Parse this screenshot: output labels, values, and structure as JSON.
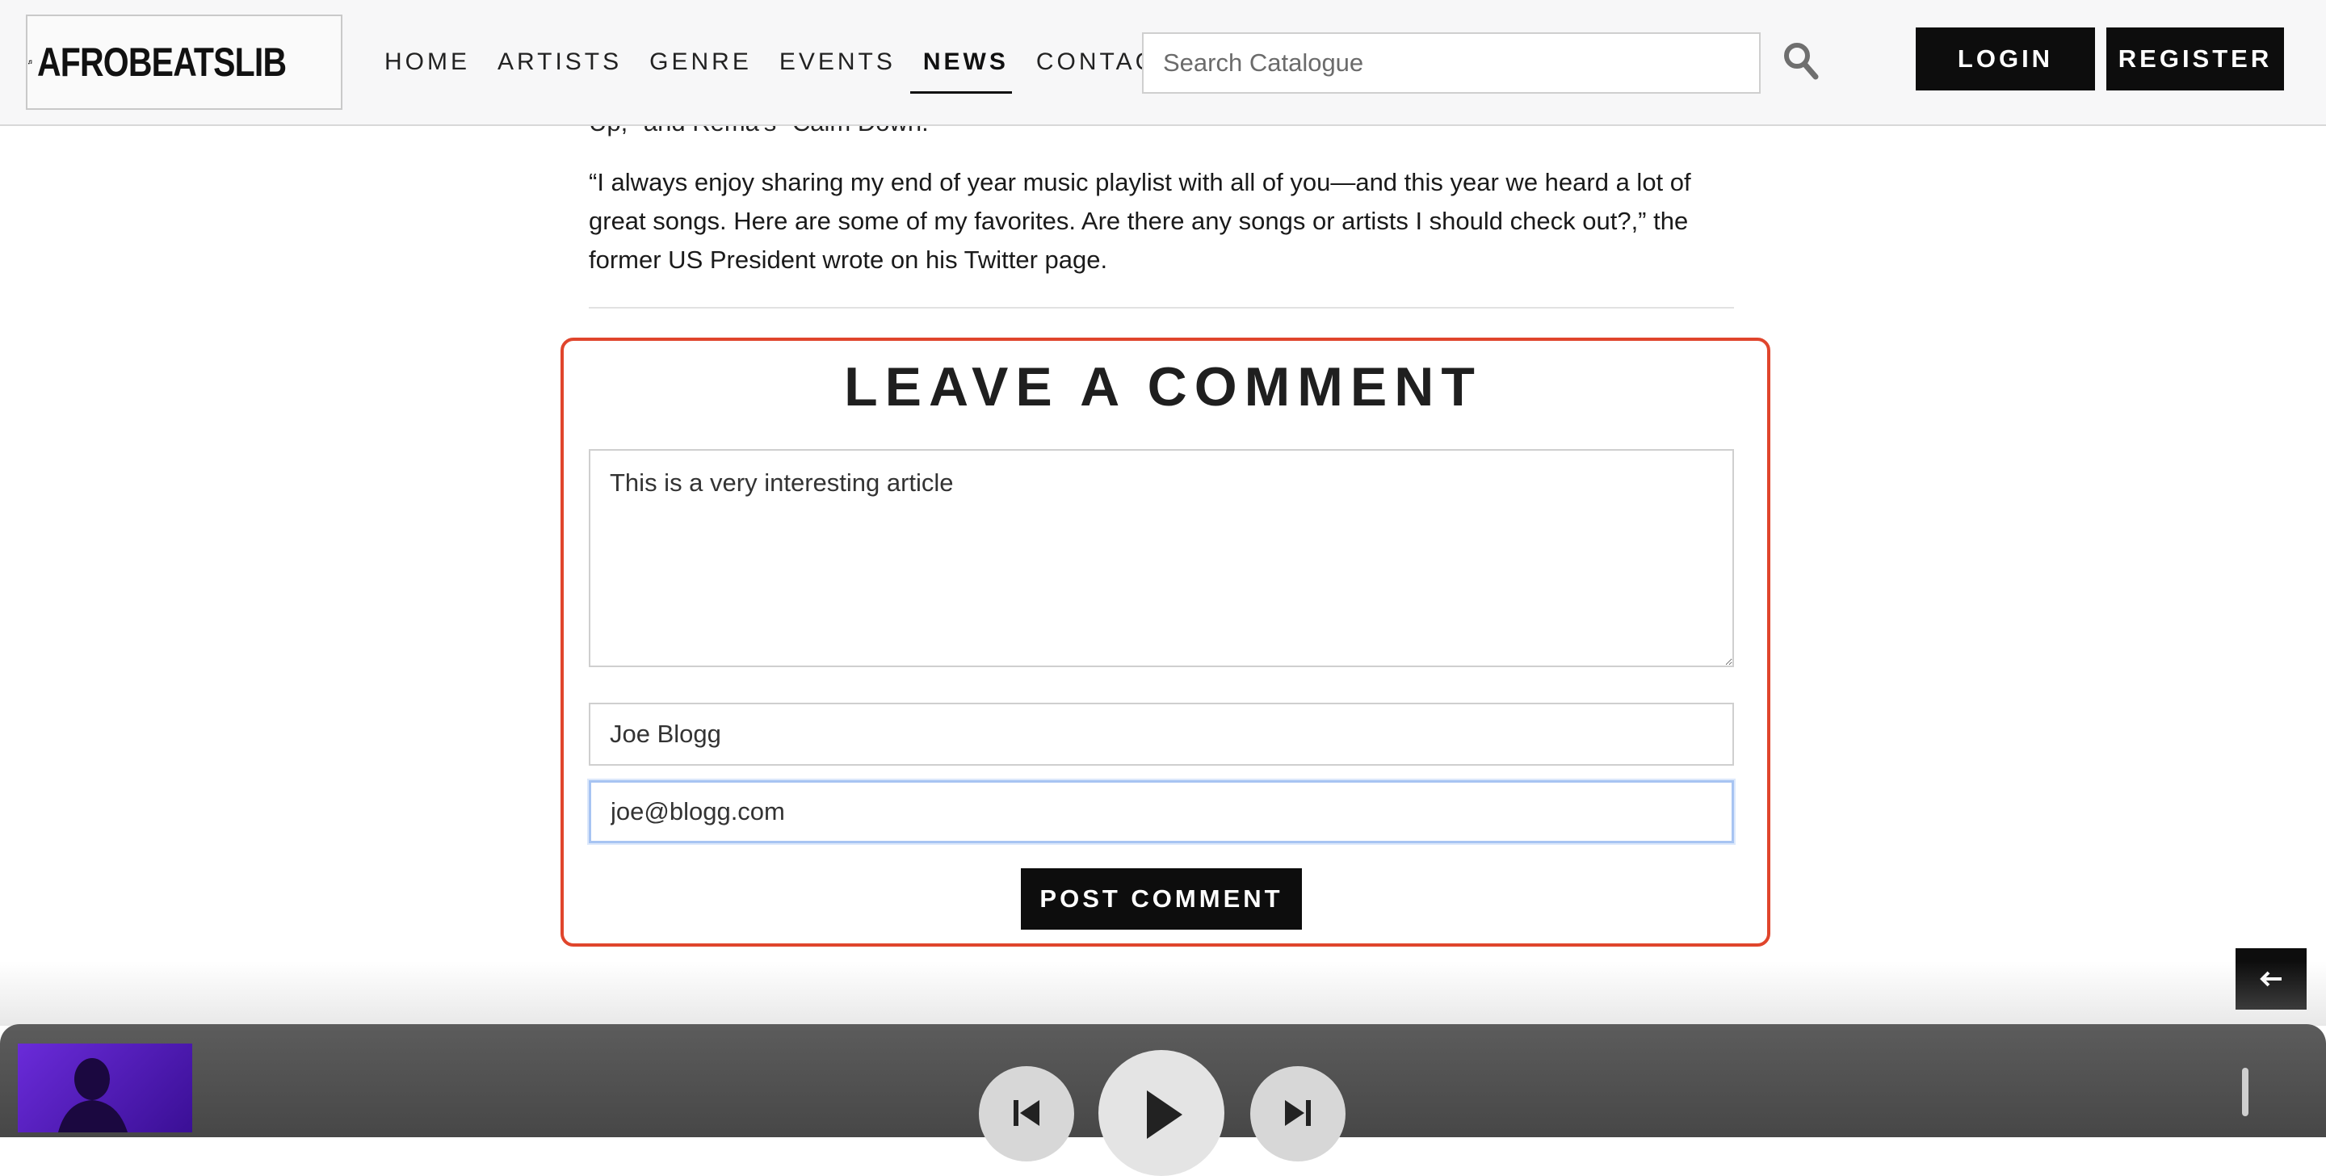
{
  "header": {
    "logo_text": "AFROBEATSLIB",
    "nav": [
      {
        "label": "HOME",
        "active": false
      },
      {
        "label": "ARTISTS",
        "active": false
      },
      {
        "label": "GENRE",
        "active": false
      },
      {
        "label": "EVENTS",
        "active": false
      },
      {
        "label": "NEWS",
        "active": true
      },
      {
        "label": "CONTACT",
        "active": false
      }
    ],
    "search_placeholder": "Search Catalogue",
    "search_icon": "search-icon",
    "login_label": "LOGIN",
    "register_label": "REGISTER"
  },
  "article": {
    "partial_line": "Up,\" and Rema's \"Calm Down.\"",
    "quote": "“I always enjoy sharing my end of year music playlist with all of you—and this year we heard a lot of great songs. Here are some of my favorites. Are there any songs or artists I should check out?,” the former US President wrote on his Twitter page."
  },
  "comment_form": {
    "title": "LEAVE A COMMENT",
    "comment_value": "This is a very interesting article",
    "name_value": "Joe Blogg",
    "email_value": "joe@blogg.com",
    "submit_label": "POST COMMENT",
    "highlight_color": "#e0452c"
  },
  "back_button": {
    "icon": "arrow-left-icon"
  },
  "player": {
    "prev_icon": "skip-back-icon",
    "play_icon": "play-icon",
    "next_icon": "skip-forward-icon"
  }
}
